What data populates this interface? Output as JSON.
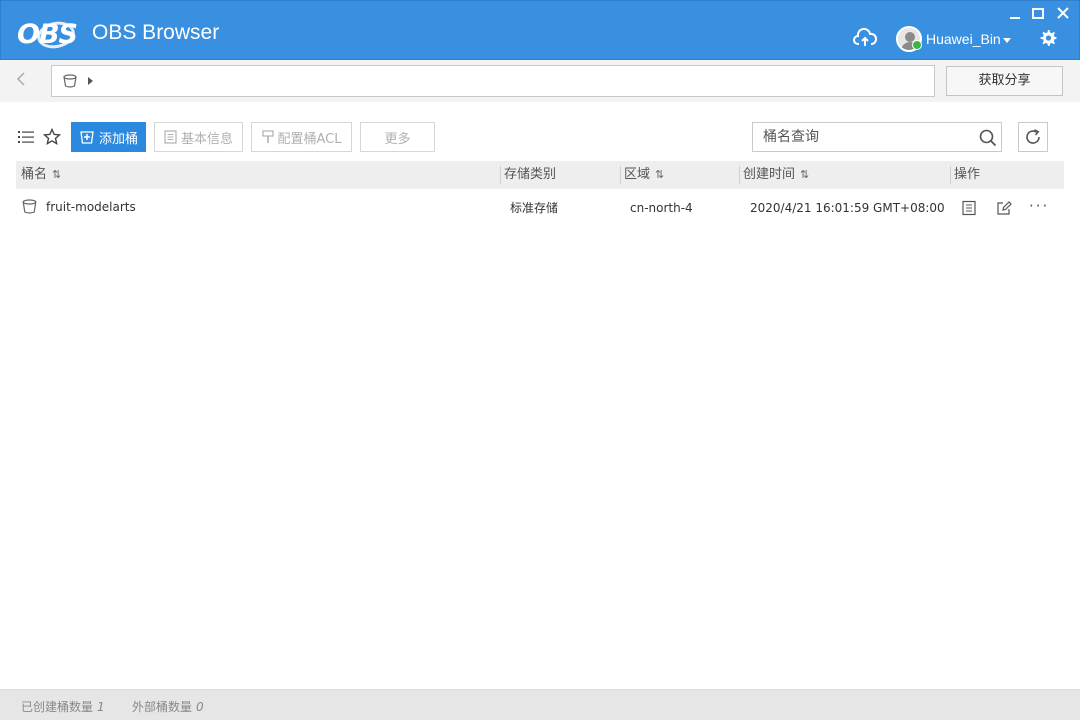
{
  "app": {
    "logo_text": "OBS",
    "title": "OBS Browser"
  },
  "user": {
    "name": "Huawei_Bin"
  },
  "path": {
    "value": ""
  },
  "share_button": "获取分享",
  "toolbar": {
    "add_bucket": "添加桶",
    "basic_info": "基本信息",
    "config_acl": "配置桶ACL",
    "more": "更多"
  },
  "search": {
    "placeholder": "桶名查询"
  },
  "table": {
    "columns": [
      {
        "label": "桶名",
        "sortable": true
      },
      {
        "label": "存储类别",
        "sortable": false
      },
      {
        "label": "区域",
        "sortable": true
      },
      {
        "label": "创建时间",
        "sortable": true
      },
      {
        "label": "操作",
        "sortable": false
      }
    ],
    "sort_glyph": "⇅",
    "rows": [
      {
        "name": "fruit-modelarts",
        "storage_class": "标准存储",
        "region": "cn-north-4",
        "created": "2020/4/21 16:01:59 GMT+08:00",
        "more": "···"
      }
    ]
  },
  "status": {
    "created_label": "已创建桶数量",
    "created_count": "1",
    "external_label": "外部桶数量",
    "external_count": "0"
  },
  "colors": {
    "titlebar": "#3a90e0",
    "primary_button": "#2b8ae0",
    "online_badge": "#3bb54a"
  },
  "icons": [
    "cloud-upload-icon",
    "avatar-icon",
    "settings-gear-icon",
    "back-arrow-icon",
    "bucket-icon",
    "list-view-icon",
    "star-icon",
    "add-bucket-icon",
    "document-icon",
    "acl-icon",
    "search-icon",
    "refresh-icon",
    "details-icon",
    "edit-icon",
    "more-icon"
  ]
}
